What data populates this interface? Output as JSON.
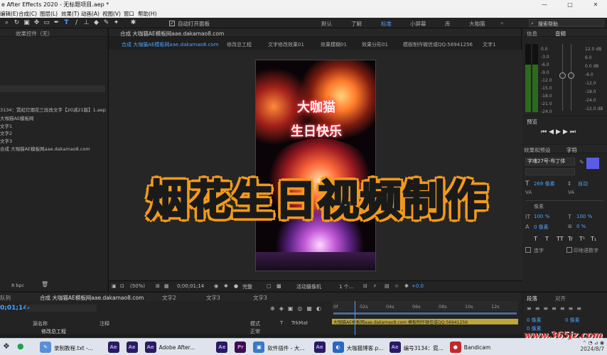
{
  "window": {
    "title": "e After Effects 2020 - 无标题项目.aep *",
    "controls": [
      "—",
      "□",
      "✕"
    ]
  },
  "menu": [
    "编辑(E)",
    "合成(C)",
    "图层(L)",
    "效果(T)",
    "动画(A)",
    "视图(V)",
    "窗口",
    "帮助(H)"
  ],
  "toolbar": {
    "auto_open_label": "自动打开面板",
    "workspaces": [
      "默认",
      "了解",
      "标准",
      "小屏幕",
      "库",
      "大咖猫"
    ],
    "active_workspace": "标准",
    "search_label": "搜索帮助"
  },
  "left_panel": {
    "header": "效果控件（无）",
    "project_item": "3134：霓虹灯烟花三段改文字【20减21版】1.aep",
    "tree": [
      "大咖猫AE模板网",
      "文字1",
      "文字2",
      "文字3",
      "合成 大咖猫AE模板网aae.dakamao8.com"
    ],
    "bpc": "8 bpc"
  },
  "comp": {
    "header": "合成 大咖猫AE模板网aae.dakamao8.com",
    "tabs": [
      "合成 大咖猫AE模板网aae.dakamao8.com",
      "修改总工程",
      "文字修改效果01",
      "效果模糊01",
      "效果分形01",
      "模板制作微信或QQ:56941256",
      "文字1"
    ],
    "phone_text_line1": "大咖猫",
    "phone_text_line2": "生日快乐",
    "overlay_title": "烟花生日视频制作",
    "footer": {
      "zoom": "(50%)",
      "timecode": "0;00;01;14",
      "quality": "完整",
      "camera": "活动摄像机",
      "views": "1 个...",
      "exposure": "+0.0"
    }
  },
  "right_panel": {
    "info_tab": "信息",
    "audio_tab": "音频",
    "db_left": [
      "0.0",
      "-3.0",
      "-6.0",
      "-9.0",
      "-12.0",
      "-15.0",
      "-18.0",
      "-21.0",
      "-24.0"
    ],
    "db_right": [
      "12.0 dB",
      "6.0",
      "0.0 dB",
      "-6.0",
      "-12.0",
      "-18.0",
      "-24.0",
      "-12.0 dB"
    ],
    "preview_tab": "预览",
    "effects_tab": "效果和预设",
    "char_tab": "字符",
    "font_name": "字魂27号-布丁体",
    "font_size": "269 像素",
    "leading": "自动",
    "tracking_unit": "像素",
    "scale_h": "100 %",
    "scale_v": "100 %",
    "baseline": "0 像素",
    "tsume": "0 %",
    "text_styles": [
      "T",
      "T",
      "TT",
      "Tr",
      "T¹",
      "T₁"
    ],
    "ligature": "连字",
    "hindi": "印地语数字",
    "para_tab": "段落",
    "align_tab": "对齐",
    "para_values": [
      "0 像素",
      "0 像素",
      "0 像素"
    ]
  },
  "timeline": {
    "tabs": [
      "队列",
      "合成 大咖猫AE模板网aae.dakamao8.com",
      "文字2",
      "文字3",
      "文字3"
    ],
    "timecode": "0;01;14",
    "columns": [
      "源名称",
      "注释",
      "模式",
      "T",
      "TrkMat"
    ],
    "ruler": [
      "0f",
      "02s",
      "04s",
      "06s",
      "08s",
      "10s",
      "12s"
    ],
    "layer_name": "修改总工程",
    "layer_mode": "正常",
    "layer_bar": "大咖猫AE模板网aae.dakamao8.com    模板制作微信或QQ:56941256"
  },
  "taskbar": {
    "apps": [
      {
        "icon": "notepad-icon",
        "label": "录制教程.txt -..."
      },
      {
        "icon": "ae-icon",
        "label": ""
      },
      {
        "icon": "ae-icon",
        "label": ""
      },
      {
        "icon": "ae-icon",
        "label": "Adobe After..."
      },
      {
        "icon": "ae-icon",
        "label": ""
      },
      {
        "icon": "pr-icon",
        "label": ""
      },
      {
        "icon": "plugin-icon",
        "label": "软件插件 - 大..."
      },
      {
        "icon": "ae-icon",
        "label": ""
      },
      {
        "icon": "bilibili-icon",
        "label": "大咖猫博客.p..."
      },
      {
        "icon": "ae-icon",
        "label": "编号3134：霓..."
      },
      {
        "icon": "bandicam-icon",
        "label": "Bandicam"
      }
    ],
    "date": "2024/8/7"
  },
  "watermark": "www.365jz.com",
  "colors": {
    "accent": "#4aa3ff",
    "title_stroke": "#f39a1a",
    "layer_bar": "#bda63a",
    "swatch": "#5b5ce6"
  }
}
